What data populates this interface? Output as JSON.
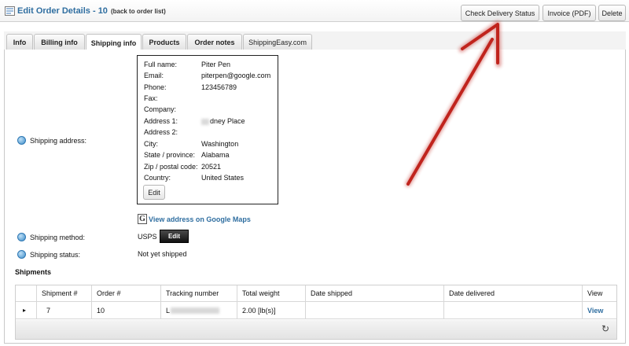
{
  "header": {
    "title": "Edit Order Details - 10",
    "back_link": "(back to order list)",
    "buttons": {
      "check_delivery": "Check Delivery Status",
      "invoice": "Invoice (PDF)",
      "delete": "Delete"
    }
  },
  "tabs": [
    {
      "label": "Info"
    },
    {
      "label": "Billing info"
    },
    {
      "label": "Shipping info"
    },
    {
      "label": "Products"
    },
    {
      "label": "Order notes"
    },
    {
      "label": "ShippingEasy.com"
    }
  ],
  "shipping": {
    "address_label": "Shipping address:",
    "address": {
      "full_name_label": "Full name:",
      "full_name": "Piter Pen",
      "email_label": "Email:",
      "email": "piterpen@google.com",
      "phone_label": "Phone:",
      "phone": "123456789",
      "fax_label": "Fax:",
      "company_label": "Company:",
      "address1_label": "Address 1:",
      "address1": "dney Place",
      "address2_label": "Address 2:",
      "city_label": "City:",
      "city": "Washington",
      "state_label": "State / province:",
      "state": "Alabama",
      "zip_label": "Zip / postal code:",
      "zip": "20521",
      "country_label": "Country:",
      "country": "United States",
      "edit_button": "Edit"
    },
    "maps_icon": "G",
    "maps_link": "View address on Google Maps",
    "method_label": "Shipping method:",
    "method_value": "USPS",
    "method_edit": "Edit",
    "status_label": "Shipping status:",
    "status_value": "Not yet shipped"
  },
  "shipments": {
    "title": "Shipments",
    "columns": [
      "",
      "Shipment #",
      "Order #",
      "Tracking number",
      "Total weight",
      "Date shipped",
      "Date delivered",
      "View"
    ],
    "rows": [
      {
        "expander": "▸",
        "shipment": "7",
        "order": "10",
        "tracking": "L",
        "weight": "2.00 [lb(s)]",
        "date_shipped": "",
        "date_delivered": "",
        "view": "View"
      }
    ],
    "refresh_icon": "↻"
  },
  "icons": {
    "title_icon": "order-edit-icon",
    "info_icon": "info-icon",
    "maps_icon": "google-maps-icon",
    "refresh_icon": "refresh-icon"
  },
  "colors": {
    "title": "#2f6ea0",
    "link": "#2f6ea0",
    "annotation_arrow": "#c0241d"
  }
}
